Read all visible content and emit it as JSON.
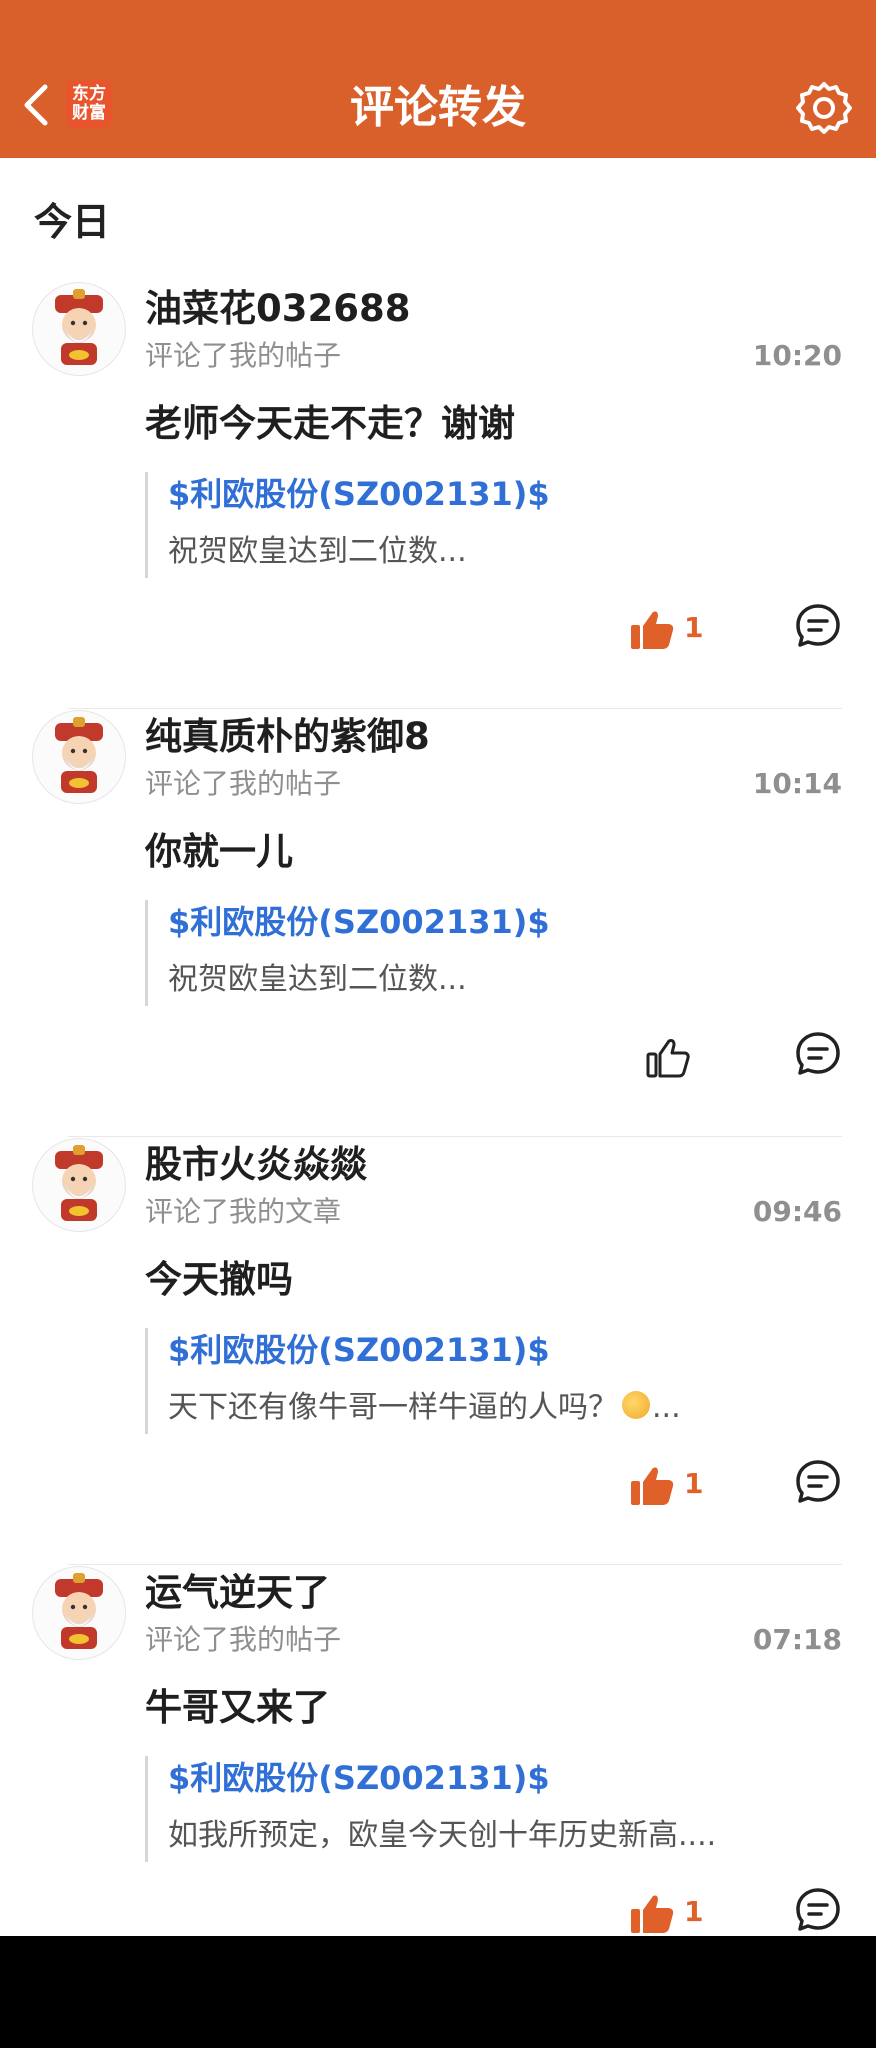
{
  "header": {
    "title": "评论转发",
    "logo_line1": "东方",
    "logo_line2": "财富",
    "accent_color": "#d95f2b"
  },
  "section": {
    "label": "今日"
  },
  "posts": [
    {
      "username": "油菜花032688",
      "action": "评论了我的帖子",
      "time": "10:20",
      "comment": "老师今天走不走？谢谢",
      "quote_link": "$利欧股份(SZ002131)$",
      "quote_text": "祝贺欧皇达到二位数...",
      "like_count": "1",
      "liked": true
    },
    {
      "username": "纯真质朴的紫御8",
      "action": "评论了我的帖子",
      "time": "10:14",
      "comment": "你就一儿",
      "quote_link": "$利欧股份(SZ002131)$",
      "quote_text": "祝贺欧皇达到二位数...",
      "like_count": "",
      "liked": false
    },
    {
      "username": "股市火炎焱燚",
      "action": "评论了我的文章",
      "time": "09:46",
      "comment": "今天撤吗",
      "quote_link": "$利欧股份(SZ002131)$",
      "quote_text": "天下还有像牛哥一样牛逼的人吗？",
      "quote_text_suffix": "...",
      "like_count": "1",
      "liked": true
    },
    {
      "username": "运气逆天了",
      "action": "评论了我的帖子",
      "time": "07:18",
      "comment": "牛哥又来了",
      "quote_link": "$利欧股份(SZ002131)$",
      "quote_text": "如我所预定，欧皇今天创十年历史新高....",
      "like_count": "1",
      "liked": true
    }
  ]
}
